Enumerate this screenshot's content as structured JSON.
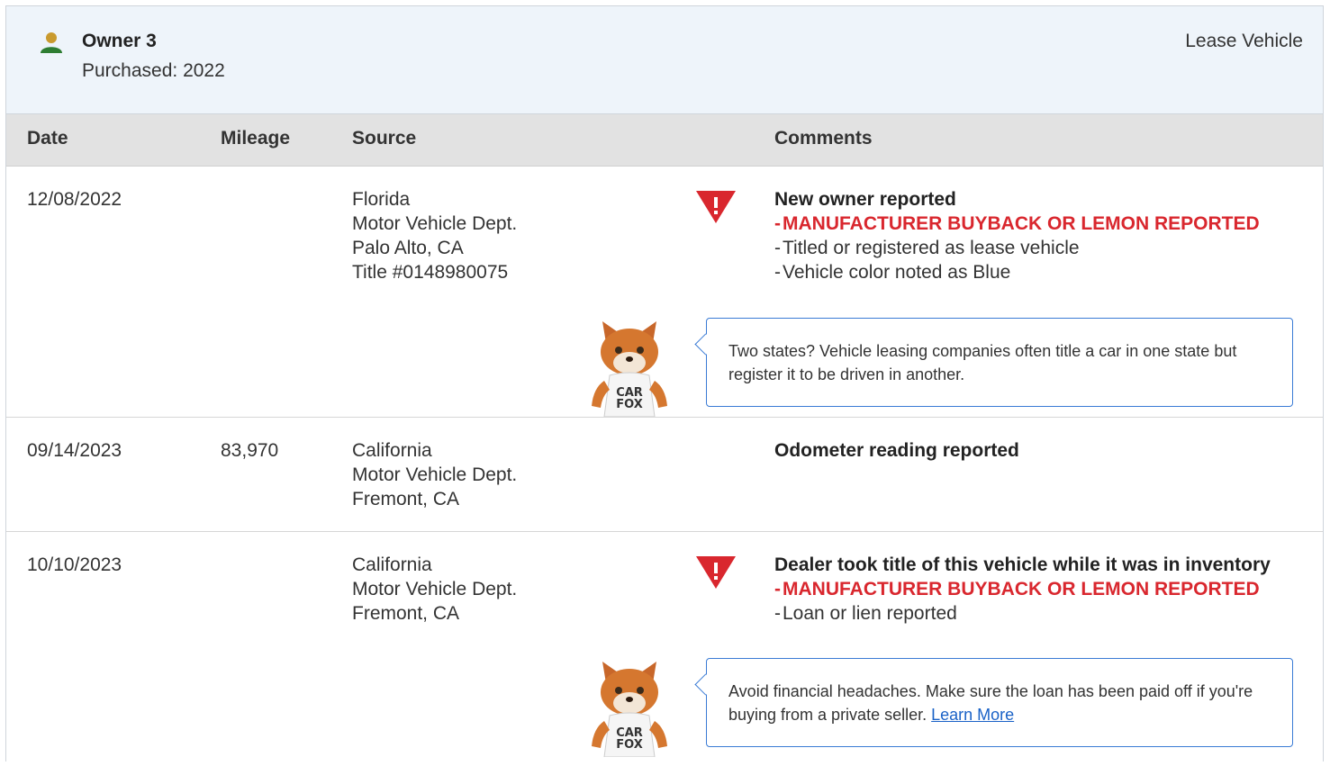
{
  "owner": {
    "title": "Owner 3",
    "purchased": "Purchased: 2022",
    "type": "Lease Vehicle",
    "icon": "person-icon",
    "icon_color": "#2e7d32"
  },
  "columns": {
    "date": "Date",
    "mileage": "Mileage",
    "source": "Source",
    "comments": "Comments"
  },
  "colors": {
    "alert": "#d9272e",
    "link": "#1a62c7",
    "header_bg": "#eef4fa"
  },
  "rows": [
    {
      "date": "12/08/2022",
      "mileage": "",
      "source": [
        "Florida",
        "Motor Vehicle Dept.",
        "Palo Alto, CA",
        "Title #0148980075"
      ],
      "comment_title": "New owner reported",
      "comment_lines": [
        "MANUFACTURER BUYBACK OR LEMON REPORTED",
        "Titled or registered as lease vehicle",
        "Vehicle color noted as Blue"
      ],
      "tip": "Two states? Vehicle leasing companies often title a car in one state but register it to be driven in another."
    },
    {
      "date": "09/14/2023",
      "mileage": "83,970",
      "source": [
        "California",
        "Motor Vehicle Dept.",
        "Fremont, CA"
      ],
      "comment_title": "Odometer reading reported"
    },
    {
      "date": "10/10/2023",
      "mileage": "",
      "source": [
        "California",
        "Motor Vehicle Dept.",
        "Fremont, CA"
      ],
      "comment_title": "Dealer took title of this vehicle while it was in inventory",
      "comment_lines": [
        "MANUFACTURER BUYBACK OR LEMON REPORTED",
        "Loan or lien reported"
      ],
      "tip": "Avoid financial headaches. Make sure the loan has been paid off if you're buying from a private seller.",
      "tip_link": "Learn More"
    }
  ],
  "fox": {
    "shirt_line1": "CAR",
    "shirt_line2": "FOX"
  },
  "dash": "-"
}
